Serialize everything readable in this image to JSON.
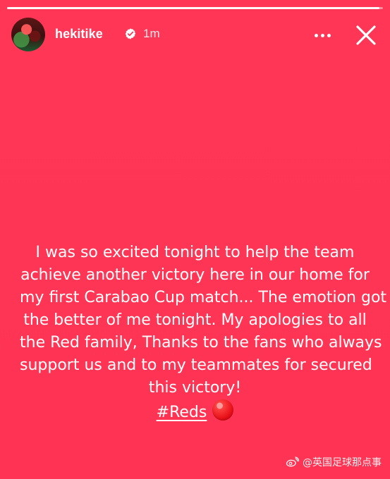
{
  "story": {
    "progress_percent": 99,
    "user": {
      "username": "hekitike",
      "time_ago": "1m"
    },
    "icons": {
      "avatar": "profile-avatar",
      "verified": "verified-badge-icon",
      "more": "more-options-icon",
      "close": "close-icon",
      "emoji": "red-circle-emoji"
    },
    "caption": {
      "lines": [
        "I was so excited tonight to help the team",
        "achieve another victory here in our home for",
        "my first Carabao Cup match... The emotion got",
        "the better of me tonight. My apologies to all",
        "the Red family, Thanks to the fans who always",
        "support us and to my teammates for secured",
        "this victory!"
      ],
      "hashtag": "#Reds"
    },
    "watermark": {
      "text": "@英国足球那点事"
    },
    "colors": {
      "background": "#ff3555",
      "text": "#ffffff",
      "emoji": "#e60f18"
    }
  }
}
